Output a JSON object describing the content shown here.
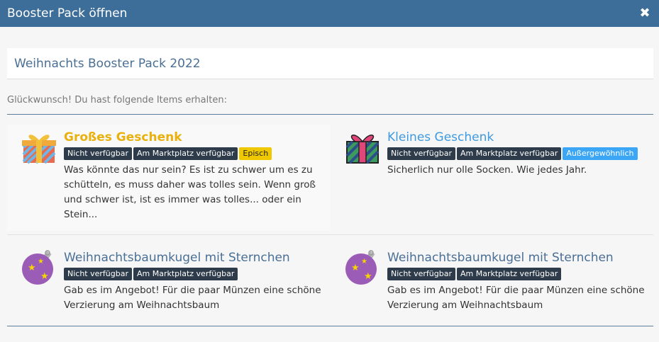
{
  "window": {
    "title": "Booster Pack öffnen",
    "close_icon": "close-icon"
  },
  "pack": {
    "title": "Weihnachts Booster Pack 2022"
  },
  "message": "Glückwunsch! Du hast folgende Items erhalten:",
  "colors": {
    "titlebar": "#3d6d99",
    "epic": "#e8b10e",
    "rare": "#3e9ae0",
    "badge_dark": "#2e3b4a"
  },
  "items": [
    {
      "name": "Großes Geschenk",
      "icon": "big-gift-icon",
      "badges": [
        "Nicht verfügbar",
        "Am Marktplatz verfügbar",
        "Episch"
      ],
      "description": "Was könnte das nur sein? Es ist zu schwer um es zu schütteln, es muss daher was tolles sein. Wenn groß und schwer ist, ist es immer was tolles... oder ein Stein..."
    },
    {
      "name": "Kleines Geschenk",
      "icon": "small-gift-icon",
      "badges": [
        "Nicht verfügbar",
        "Am Marktplatz verfügbar",
        "Außergewöhnlich"
      ],
      "description": "Sicherlich nur olle Socken. Wie jedes Jahr."
    },
    {
      "name": "Weihnachtsbaumkugel mit Sternchen",
      "icon": "bauble-icon",
      "badges": [
        "Nicht verfügbar",
        "Am Marktplatz verfügbar"
      ],
      "description": "Gab es im Angebot! Für die paar Münzen eine schöne Verzierung am Weihnachtsbaum"
    },
    {
      "name": "Weihnachtsbaumkugel mit Sternchen",
      "icon": "bauble-icon",
      "badges": [
        "Nicht verfügbar",
        "Am Marktplatz verfügbar"
      ],
      "description": "Gab es im Angebot! Für die paar Münzen eine schöne Verzierung am Weihnachtsbaum"
    }
  ]
}
